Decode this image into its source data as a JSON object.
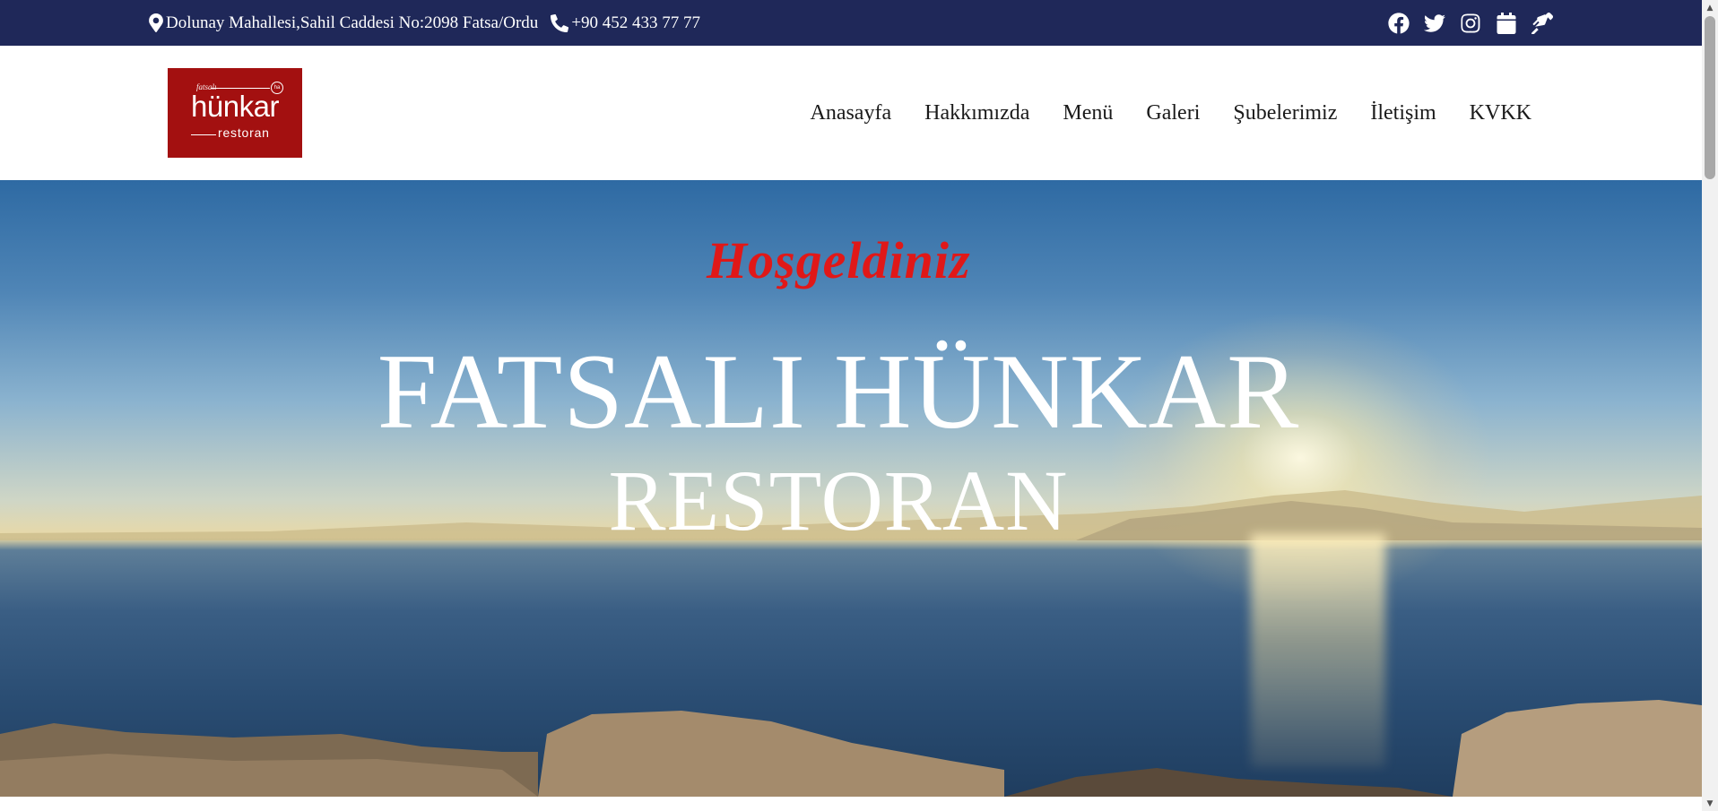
{
  "topbar": {
    "address": "Dolunay Mahallesi,Sahil Caddesi No:2098 Fatsa/Ordu",
    "phone": "+90 452 433 77 77",
    "social": [
      "facebook-icon",
      "twitter-icon",
      "instagram-icon",
      "calendar-icon",
      "pen-icon"
    ]
  },
  "logo": {
    "small_text": "fatsalı",
    "badge": "ha",
    "main_text": "hünkar",
    "sub_text": "restoran",
    "background_color": "#a31010"
  },
  "nav": {
    "items": [
      "Anasayfa",
      "Hakkımızda",
      "Menü",
      "Galeri",
      "Şubelerimiz",
      "İletişim",
      "KVKK"
    ]
  },
  "hero": {
    "welcome": "Hoşgeldiniz",
    "title_line1": "FATSALI HÜNKAR",
    "title_line2": "RESTORAN"
  },
  "colors": {
    "topbar": "#1f2859",
    "welcome_text": "#e01818",
    "hero_text": "#ffffff"
  }
}
